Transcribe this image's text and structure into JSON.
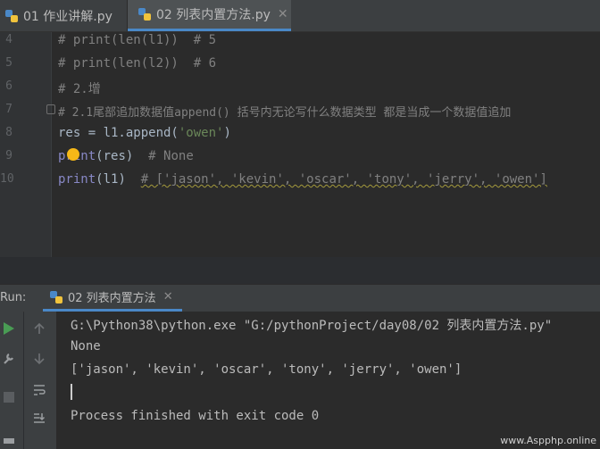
{
  "editor_tabs": [
    {
      "label": "01 作业讲解.py",
      "active": false
    },
    {
      "label": "02 列表内置方法.py",
      "active": true
    }
  ],
  "close_glyph": "✕",
  "editor": {
    "line_numbers": [
      "4",
      "5",
      "6",
      "7",
      "8",
      "9",
      "10"
    ],
    "lines": {
      "l4": "# print(len(l1))  # 5",
      "l5": "# print(len(l2))  # 6",
      "l6": "# 2.增",
      "l7": "# 2.1尾部追加数据值append() 括号内无论写什么数据类型 都是当成一个数据值追加",
      "l8_pre": "res = l1.append(",
      "l8_str": "'owen'",
      "l8_post": ")",
      "l9_fn": "print",
      "l9_rest": "(res)  ",
      "l9_cmt": "# None",
      "l10_fn": "print",
      "l10_rest": "(l1)  ",
      "l10_cmt": "# ['jason', 'kevin', 'oscar', 'tony', 'jerry', 'owen']"
    }
  },
  "run_panel": {
    "label": "Run:",
    "tab_label": "02 列表内置方法",
    "console_lines": [
      "G:\\Python38\\python.exe \"G:/pythonProject/day08/02 列表内置方法.py\"",
      "None",
      "['jason', 'kevin', 'oscar', 'tony', 'jerry', 'owen']",
      "",
      "Process finished with exit code 0"
    ]
  },
  "watermark": "www.Aspphp.online",
  "colors": {
    "accent": "#4a88c7",
    "run_green": "#499c54",
    "bulb": "#f6b818"
  }
}
